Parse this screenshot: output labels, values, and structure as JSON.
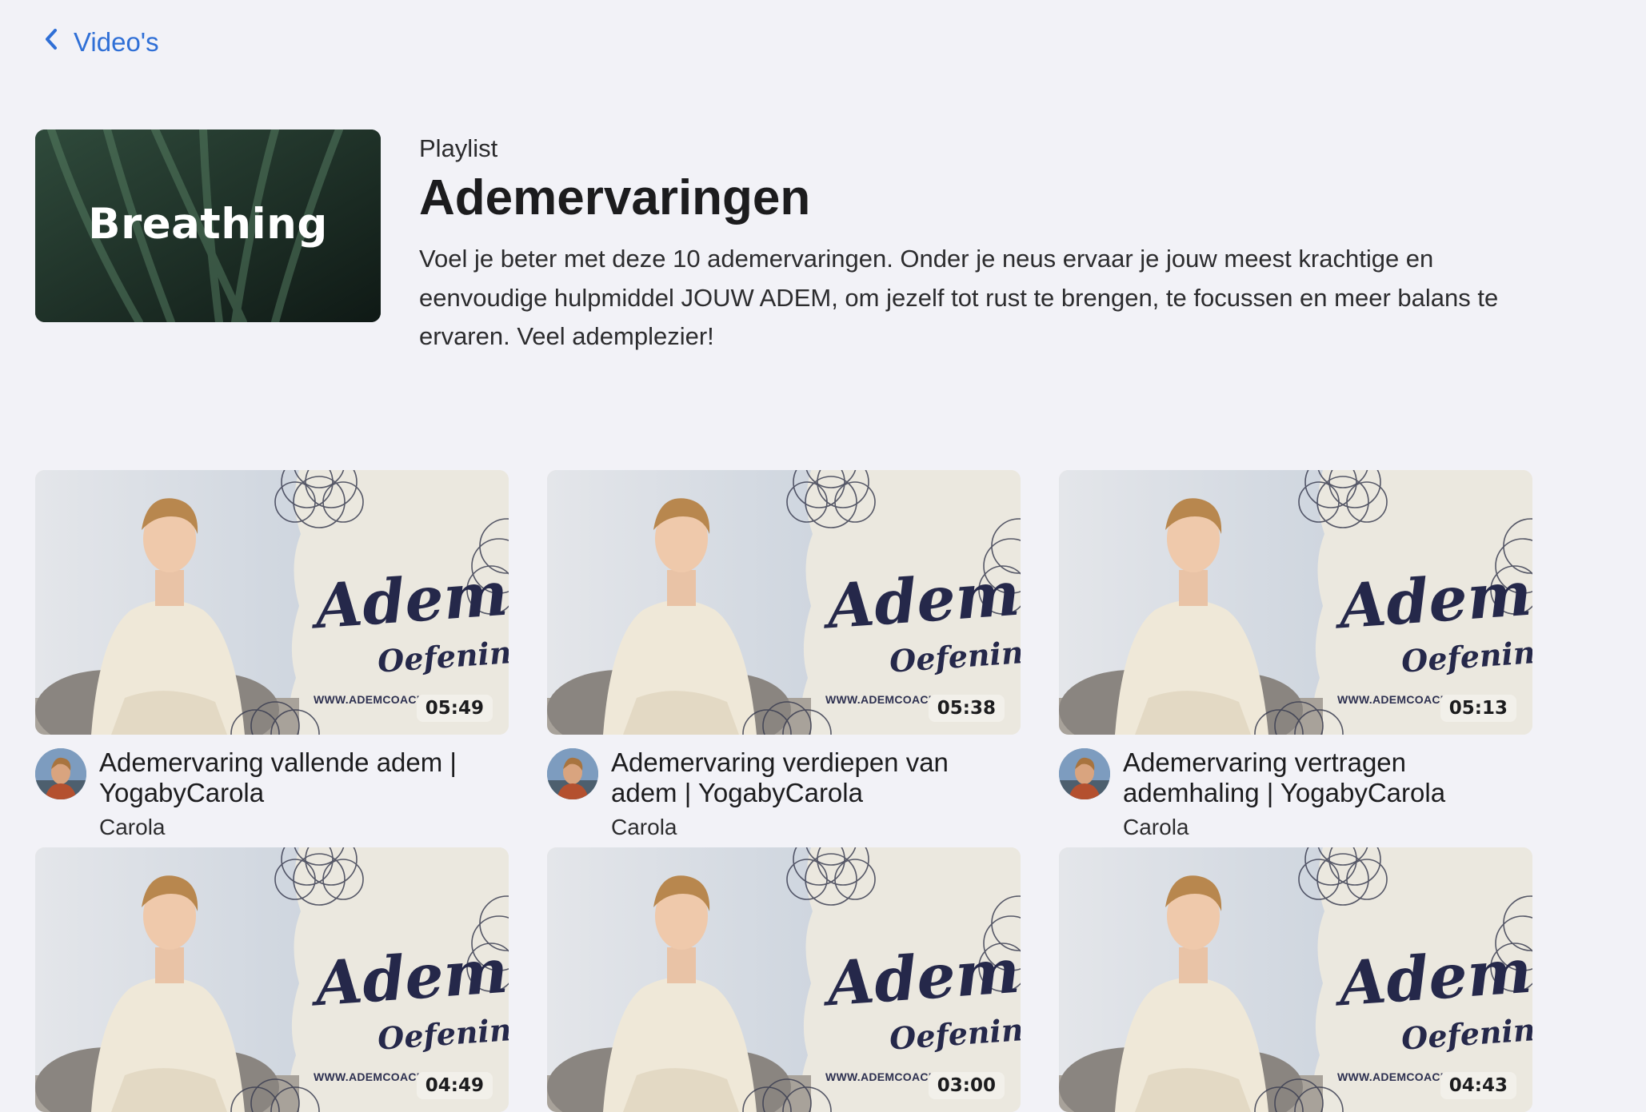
{
  "nav": {
    "back_label": "Video's"
  },
  "playlist": {
    "cover_text": "Breathing",
    "kicker": "Playlist",
    "title": "Ademervaringen",
    "description": "Voel je beter met deze 10 ademervaringen. Onder je neus ervaar je jouw meest krachtige en eenvoudige hulpmiddel JOUW ADEM, om jezelf tot rust te brengen, te focussen en meer balans te ervaren. Veel ademplezier!"
  },
  "thumbnail_text": {
    "title": "Adem",
    "subtitle": "Oefening",
    "url": "WWW.ADEMCOACH"
  },
  "videos": [
    {
      "title": "Ademervaring vallende adem | YogabyCarola",
      "author": "Carola",
      "duration": "05:49"
    },
    {
      "title": "Ademervaring verdiepen van adem | YogabyCarola",
      "author": "Carola",
      "duration": "05:38"
    },
    {
      "title": "Ademervaring vertragen ademhaling | YogabyCarola",
      "author": "Carola",
      "duration": "05:13"
    },
    {
      "title": "",
      "author": "",
      "duration": "04:49"
    },
    {
      "title": "",
      "author": "",
      "duration": "03:00"
    },
    {
      "title": "",
      "author": "",
      "duration": "04:43"
    }
  ]
}
